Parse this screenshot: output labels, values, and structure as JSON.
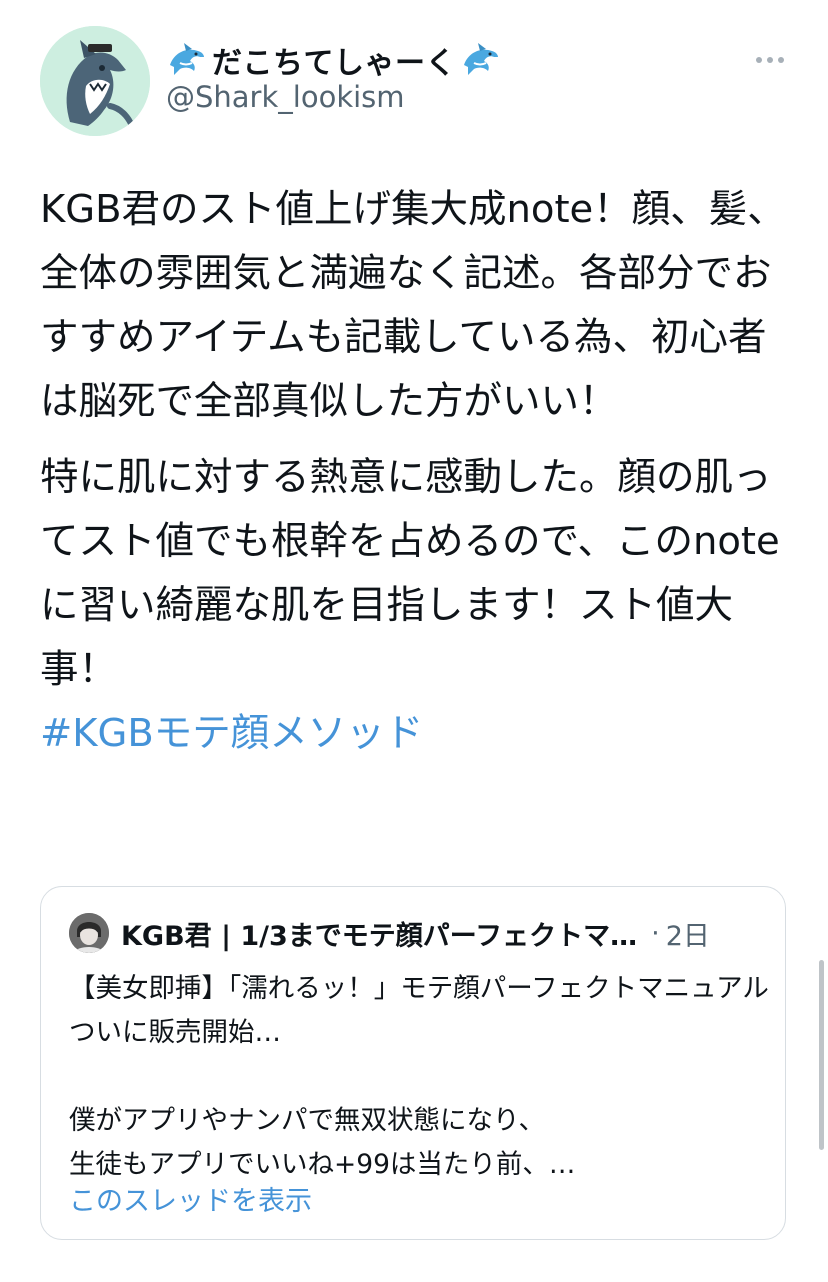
{
  "tweet": {
    "author": {
      "display_name": "だこちてしゃーく",
      "name_emoji": "dolphin-icon",
      "handle": "@Shark_lookism",
      "avatar": "shark-avatar"
    },
    "more_icon": "more-horizontal-icon",
    "paragraphs": [
      "KGB君のスト値上げ集大成note！顔、髪、全体の雰囲気と満遍なく記述。各部分でおすすめアイテムも記載している為、初心者は脳死で全部真似した方がいい！",
      "特に肌に対する熱意に感動した。顔の肌ってスト値でも根幹を占めるので、このnoteに習い綺麗な肌を目指します！スト値大事！"
    ],
    "hashtag": "#KGBモテ顔メソッド",
    "link_color": "#4593d8"
  },
  "quote": {
    "author_name": "KGB君 | 1/3までモテ顔パーフェクトマ…",
    "separator": "·",
    "time": "2日",
    "text": "【美女即挿】「濡れるッ！」モテ顔パーフェクトマニュアルついに販売開始…\n\n僕がアプリやナンパで無双状態になり、\n生徒もアプリでいいね+99は当たり前、…",
    "show_thread": "このスレッドを表示"
  }
}
